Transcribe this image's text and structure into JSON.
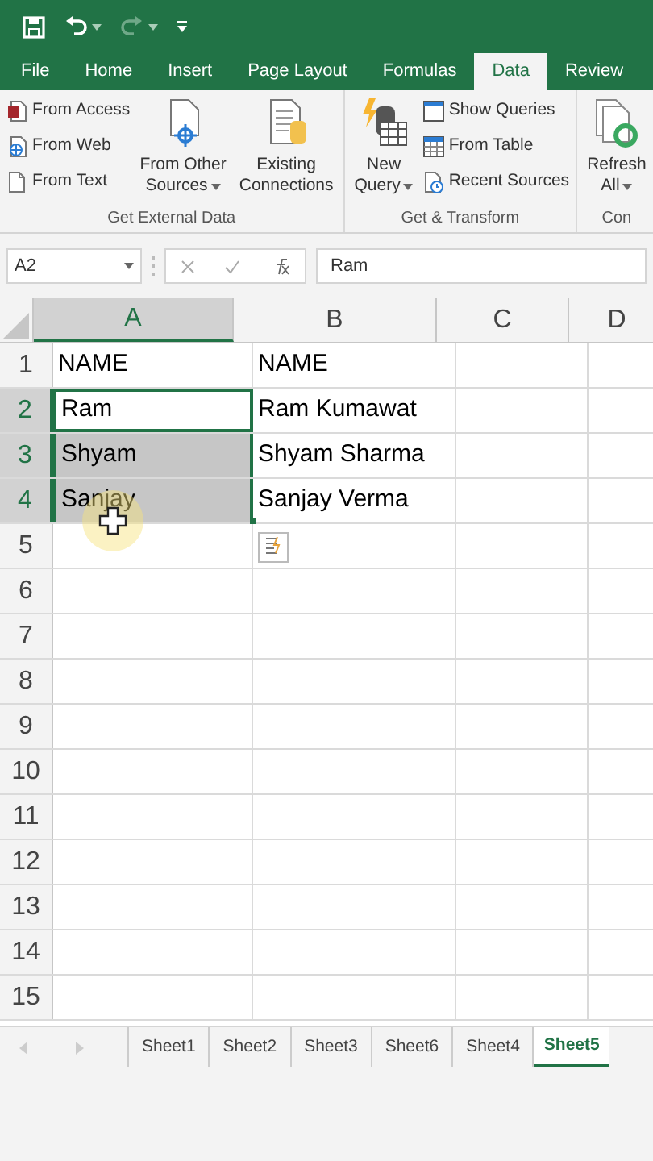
{
  "tabs": [
    {
      "label": "File",
      "selected": false
    },
    {
      "label": "Home",
      "selected": false
    },
    {
      "label": "Insert",
      "selected": false
    },
    {
      "label": "Page Layout",
      "selected": false
    },
    {
      "label": "Formulas",
      "selected": false
    },
    {
      "label": "Data",
      "selected": true
    },
    {
      "label": "Review",
      "selected": false
    }
  ],
  "ribbon": {
    "groups": [
      {
        "title": "Get External Data",
        "buttons": [
          {
            "kind": "small",
            "label": "From Access"
          },
          {
            "kind": "small",
            "label": "From Web"
          },
          {
            "kind": "small",
            "label": "From Text"
          },
          {
            "kind": "large",
            "label": "From Other",
            "label2": "Sources",
            "dropdown": true
          },
          {
            "kind": "large",
            "label": "Existing",
            "label2": "Connections",
            "dropdown": false
          }
        ]
      },
      {
        "title": "Get & Transform",
        "buttons": [
          {
            "kind": "large",
            "label": "New",
            "label2": "Query",
            "dropdown": true
          },
          {
            "kind": "small",
            "label": "Show Queries"
          },
          {
            "kind": "small",
            "label": "From Table"
          },
          {
            "kind": "small",
            "label": "Recent Sources"
          }
        ]
      },
      {
        "title": "Con",
        "buttons": [
          {
            "kind": "large",
            "label": "Refresh",
            "label2": "All",
            "dropdown": true
          }
        ]
      }
    ]
  },
  "formula_bar": {
    "name_box": "A2",
    "value": "Ram"
  },
  "columns": [
    {
      "label": "A",
      "selected": true
    },
    {
      "label": "B",
      "selected": false
    },
    {
      "label": "C",
      "selected": false
    },
    {
      "label": "D",
      "selected": false
    }
  ],
  "rows": [
    {
      "label": "1",
      "selected": false,
      "cells": [
        {
          "text": "NAME",
          "selected": false,
          "active": false
        },
        {
          "text": "NAME",
          "selected": false,
          "active": false
        },
        {
          "selected": false,
          "active": false
        }
      ]
    },
    {
      "label": "2",
      "selected": true,
      "cells": [
        {
          "text": "Ram",
          "selected": true,
          "active": true
        },
        {
          "text": "Ram Kumawat",
          "selected": false,
          "active": false
        },
        {
          "selected": false,
          "active": false
        }
      ]
    },
    {
      "label": "3",
      "selected": true,
      "cells": [
        {
          "text": "Shyam",
          "selected": true,
          "active": false
        },
        {
          "text": "Shyam Sharma",
          "selected": false,
          "active": false
        },
        {
          "selected": false,
          "active": false
        }
      ]
    },
    {
      "label": "4",
      "selected": true,
      "cells": [
        {
          "text": "Sanjay",
          "selected": true,
          "active": false
        },
        {
          "text": "Sanjay Verma",
          "selected": false,
          "active": false
        },
        {
          "selected": false,
          "active": false
        }
      ]
    },
    {
      "label": "5",
      "selected": false,
      "cells": []
    },
    {
      "label": "6",
      "selected": false,
      "cells": []
    },
    {
      "label": "7",
      "selected": false,
      "cells": []
    },
    {
      "label": "8",
      "selected": false,
      "cells": []
    },
    {
      "label": "9",
      "selected": false,
      "cells": []
    },
    {
      "label": "10",
      "selected": false,
      "cells": []
    },
    {
      "label": "11",
      "selected": false,
      "cells": []
    },
    {
      "label": "12",
      "selected": false,
      "cells": []
    },
    {
      "label": "13",
      "selected": false,
      "cells": []
    },
    {
      "label": "14",
      "selected": false,
      "cells": []
    },
    {
      "label": "15",
      "selected": false,
      "cells": []
    }
  ],
  "sheet_tabs": [
    {
      "label": "Sheet1",
      "selected": false
    },
    {
      "label": "Sheet2",
      "selected": false
    },
    {
      "label": "Sheet3",
      "selected": false
    },
    {
      "label": "Sheet6",
      "selected": false
    },
    {
      "label": "Sheet4",
      "selected": false
    },
    {
      "label": "Sheet5",
      "selected": true
    }
  ]
}
